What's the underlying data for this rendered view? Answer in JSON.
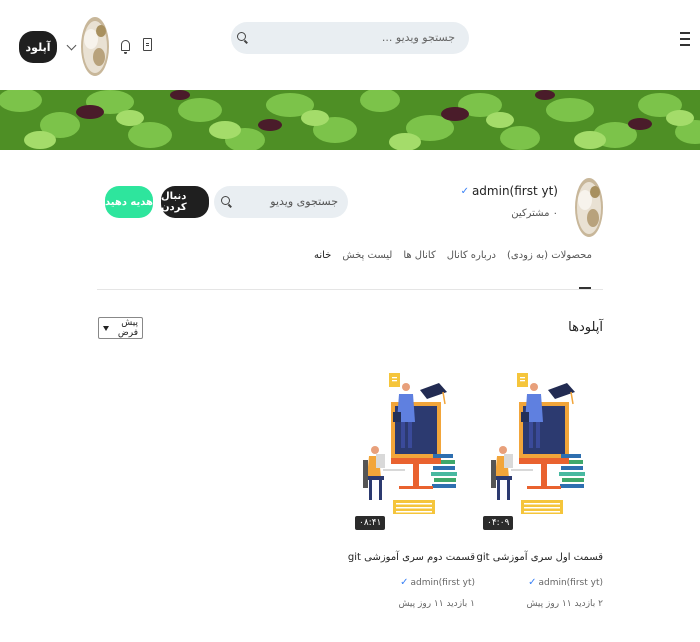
{
  "header": {
    "upload_label": "آپلود",
    "search_placeholder": "جستجو ویدیو ..."
  },
  "channel": {
    "name": "admin(first yt)",
    "subscribers": "۰ مشترکین",
    "search_placeholder": "جستجوی ویدیو",
    "follow_label": "دنبال کردن",
    "gift_label": "هدیه دهید"
  },
  "tabs": [
    {
      "label": "خانه"
    },
    {
      "label": "لیست پخش"
    },
    {
      "label": "کانال ها"
    },
    {
      "label": "درباره کانال"
    },
    {
      "label": "محصولات (به زودی)"
    }
  ],
  "section": {
    "title": "آپلودها",
    "sort_label": "پیش فرض"
  },
  "videos": [
    {
      "title": "قسمت اول سری آموزشی git",
      "author": "admin(first yt)",
      "meta": "۲ بازدید ۱۱ روز پیش",
      "duration": "۰۴:۰۹"
    },
    {
      "title": "قسمت دوم سری آموزشی git",
      "author": "admin(first yt)",
      "meta": "۱ بازدید ۱۱ روز پیش",
      "duration": "۰۸:۴۱"
    }
  ],
  "colors": {
    "accent_green": "#2ee59d",
    "dark_button": "#1f1f1f",
    "verified_blue": "#3b82f6"
  },
  "icons": [
    "menu-icon",
    "search-icon",
    "chevron-down-icon",
    "bell-icon",
    "book-icon",
    "verified-icon"
  ]
}
